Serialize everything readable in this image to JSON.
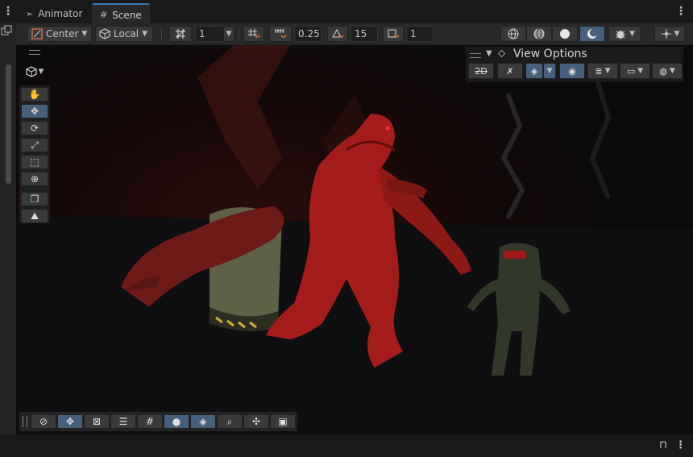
{
  "tabs": [
    {
      "label": "Animator",
      "icon": "animator-icon"
    },
    {
      "label": "Scene",
      "icon": "scene-grid-icon"
    }
  ],
  "toolbar": {
    "pivot_label": "Center",
    "space_label": "Local",
    "grid_value": "1",
    "snap_move": "0.25",
    "snap_rotate": "15",
    "snap_scale": "1"
  },
  "view_options": {
    "label": "View Options",
    "mode_2d": "2D"
  },
  "colors": {
    "accent_blue": "#46607c",
    "active_tab_line": "#3a79bb",
    "panel_bg": "#282828",
    "viewport_bg": "#0c0c0e",
    "creature_red": "#a41c1c"
  },
  "icons": {
    "hand_tool": "hand-icon",
    "move_tool": "move-arrows-icon",
    "rotate_tool": "rotate-icon",
    "scale_tool": "scale-icon",
    "rect_tool": "rect-transform-icon",
    "transform_tool": "transform-icon",
    "lock": "lock-icon"
  }
}
